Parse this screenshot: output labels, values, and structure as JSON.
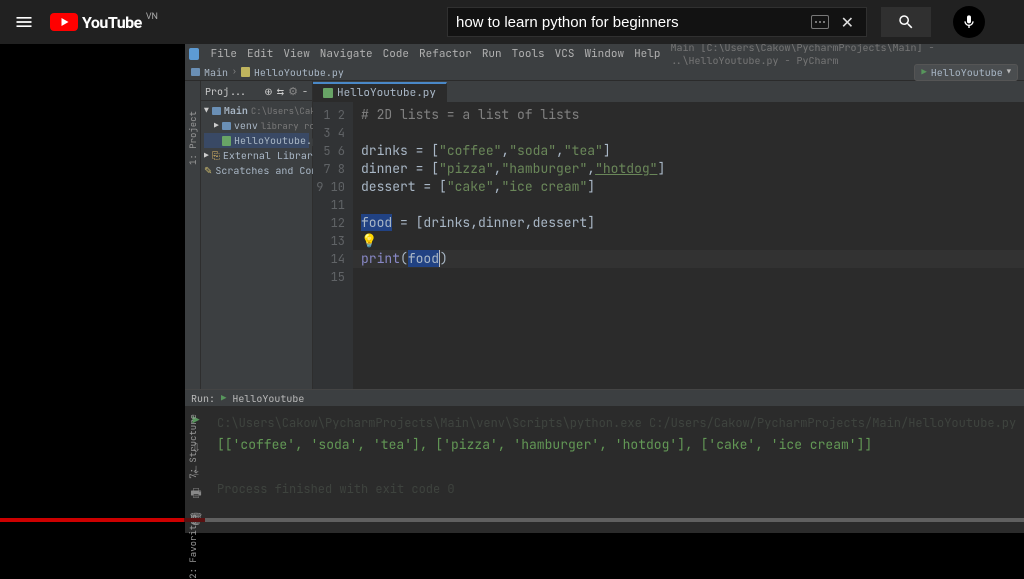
{
  "yt_header": {
    "brand": "YouTube",
    "country": "VN",
    "search_value": "how to learn python for beginners"
  },
  "ide": {
    "menu": [
      "File",
      "Edit",
      "View",
      "Navigate",
      "Code",
      "Refactor",
      "Run",
      "Tools",
      "VCS",
      "Window",
      "Help"
    ],
    "title_path": "Main [C:\\Users\\Cakow\\PycharmProjects\\Main] - ..\\HelloYoutube.py - PyCharm",
    "breadcrumb": {
      "folder": "Main",
      "file": "HelloYoutube.py"
    },
    "run_config": "HelloYoutube",
    "project": {
      "label": "Proj...",
      "root": "Main",
      "root_hint": "C:\\Users\\Cakow\\Py",
      "venv": "venv",
      "venv_hint": "library root",
      "file": "HelloYoutube.py",
      "ext_lib": "External Libraries",
      "scratches": "Scratches and Consoles"
    },
    "editor_tab": "HelloYoutube.py",
    "gutter_lines": [
      "1",
      "2",
      "3",
      "4",
      "5",
      "6",
      "7",
      "8",
      "9",
      "10",
      "11",
      "12",
      "13",
      "14",
      "15"
    ],
    "code": {
      "l1_comment": "# 2D lists = a list of lists",
      "drinks": {
        "name": "drinks",
        "eq": " = [",
        "a": "\"coffee\"",
        "c1": ",",
        "b": "\"soda\"",
        "c2": ",",
        "c": "\"tea\"",
        "end": "]"
      },
      "dinner": {
        "name": "dinner",
        "eq": " = [",
        "a": "\"pizza\"",
        "c1": ",",
        "b": "\"hamburger\"",
        "c2": ",",
        "c": "\"hotdog\"",
        "end": "]"
      },
      "dessert": {
        "name": "dessert",
        "eq": " = [",
        "a": "\"cake\"",
        "c1": ",",
        "b": "\"ice cream\"",
        "end": "]"
      },
      "food": {
        "name": "food",
        "rest": " = [drinks,dinner,dessert]"
      },
      "bulb": "💡",
      "print": {
        "fn": "print",
        "open": "(",
        "arg": "food",
        "close": ")"
      }
    },
    "run_panel": {
      "label": "Run:",
      "name": "HelloYoutube",
      "cmd_dim": "C:\\Users\\Cakow\\PycharmProjects\\Main\\venv\\Scripts\\python.exe C:/Users/Cakow/PycharmProjects/Main/HelloYoutube.py",
      "output": "[['coffee', 'soda', 'tea'], ['pizza', 'hamburger', 'hotdog'], ['cake', 'ice cream']]",
      "exit_dim": "Process finished with exit code 0"
    }
  },
  "progress": {
    "played_pct": 18,
    "buffered_pct": 2
  }
}
